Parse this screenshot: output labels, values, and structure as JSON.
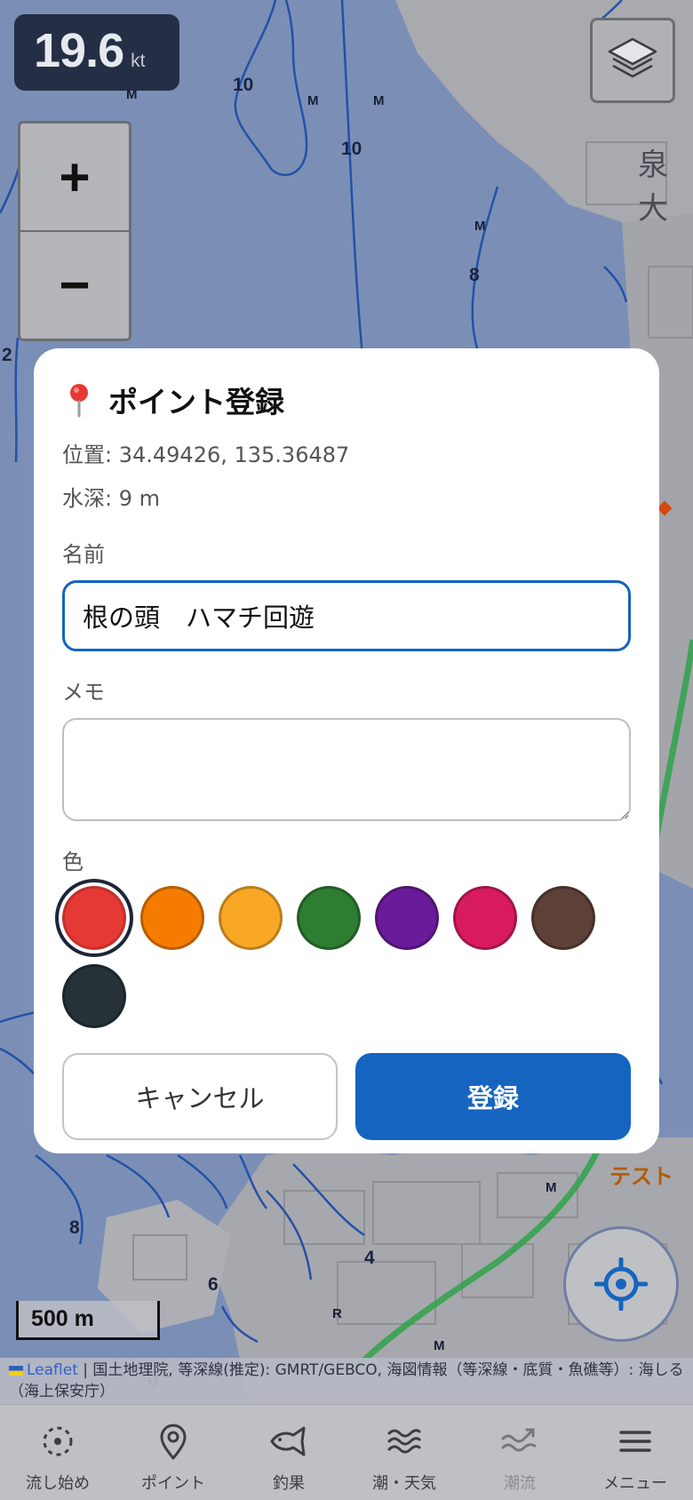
{
  "map": {
    "speed_value": "19.6",
    "speed_unit": "kt",
    "zoom_in": "+",
    "zoom_out": "−",
    "scale_label": "500 m",
    "depth_labels": [
      "10",
      "10",
      "8",
      "2",
      "8",
      "6",
      "4"
    ],
    "markers": [
      "M",
      "M",
      "M",
      "M",
      "M",
      "M",
      "M",
      "R"
    ],
    "place_fragment": "泉大",
    "test_label": "テスト",
    "attribution": {
      "leaflet": "Leaflet",
      "text": " | 国土地理院, 等深線(推定): GMRT/GEBCO, 海図情報（等深線・底質・魚礁等）: 海しる（海上保安庁）"
    }
  },
  "dialog": {
    "title": "ポイント登録",
    "position_text": "位置: 34.49426, 135.36487",
    "depth_text": "水深: 9 m",
    "name_label": "名前",
    "name_value": "根の頭　ハマチ回遊",
    "memo_label": "メモ",
    "memo_value": "",
    "color_label": "色",
    "colors": [
      {
        "hex": "#e53935",
        "selected": true
      },
      {
        "hex": "#f57c00",
        "selected": false
      },
      {
        "hex": "#f9a825",
        "selected": false
      },
      {
        "hex": "#2e7d32",
        "selected": false
      },
      {
        "hex": "#6a1b9a",
        "selected": false
      },
      {
        "hex": "#d81b60",
        "selected": false
      },
      {
        "hex": "#5d4037",
        "selected": false
      },
      {
        "hex": "#263238",
        "selected": false
      }
    ],
    "cancel_label": "キャンセル",
    "submit_label": "登録"
  },
  "nav": {
    "items": [
      {
        "label": "流し始め",
        "icon": "drift-start-icon",
        "disabled": false
      },
      {
        "label": "ポイント",
        "icon": "map-pin-icon",
        "disabled": false
      },
      {
        "label": "釣果",
        "icon": "fish-icon",
        "disabled": false
      },
      {
        "label": "潮・天気",
        "icon": "waves-icon",
        "disabled": false
      },
      {
        "label": "潮流",
        "icon": "current-icon",
        "disabled": true
      },
      {
        "label": "メニュー",
        "icon": "menu-icon",
        "disabled": false
      }
    ]
  },
  "colors": {
    "accent": "#1565c0",
    "map_water": "#7b8fb6",
    "contour": "#2451a6"
  }
}
